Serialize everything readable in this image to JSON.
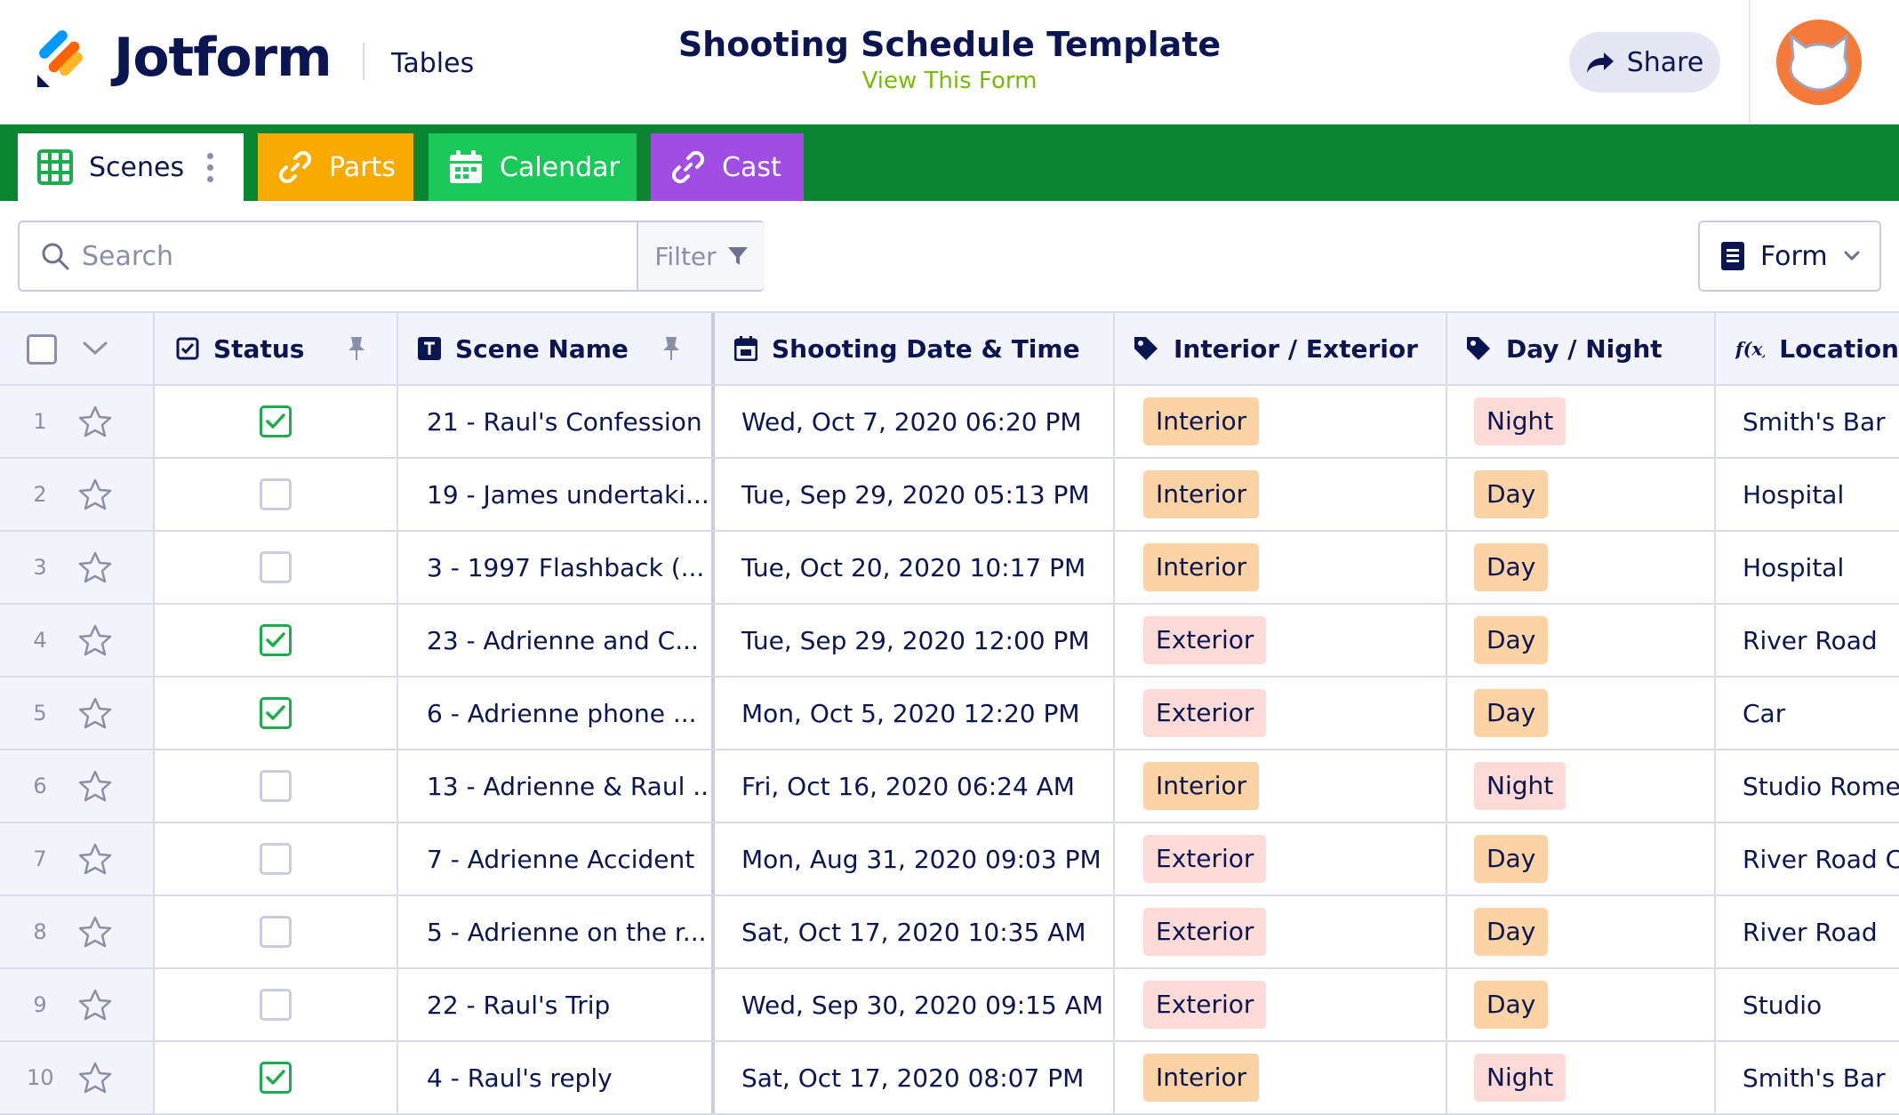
{
  "header": {
    "brand": "Jotform",
    "app_name": "Tables",
    "title": "Shooting Schedule Template",
    "subtitle_link": "View This Form",
    "share_label": "Share"
  },
  "tabs": [
    {
      "label": "Scenes",
      "color": "#ffffff"
    },
    {
      "label": "Parts",
      "color": "#f7ab00"
    },
    {
      "label": "Calendar",
      "color": "#1bc95a"
    },
    {
      "label": "Cast",
      "color": "#9f4de3"
    }
  ],
  "toolbar": {
    "search_placeholder": "Search",
    "filter_label": "Filter",
    "form_label": "Form"
  },
  "columns": {
    "status": "Status",
    "scene": "Scene Name",
    "date": "Shooting Date & Time",
    "ie": "Interior / Exterior",
    "dn": "Day / Night",
    "location": "Location"
  },
  "tag_colors": {
    "Interior": "#fbd3a4",
    "Exterior": "#fcdad7",
    "Day": "#fbd3a4",
    "Night": "#fcdad7"
  },
  "rows": [
    {
      "num": "1",
      "status": true,
      "scene": "21 - Raul's Confession",
      "date": "Wed, Oct 7, 2020 06:20 PM",
      "ie": "Interior",
      "dn": "Night",
      "location": "Smith's Bar"
    },
    {
      "num": "2",
      "status": false,
      "scene": "19 - James undertaki...",
      "date": "Tue, Sep 29, 2020 05:13 PM",
      "ie": "Interior",
      "dn": "Day",
      "location": "Hospital"
    },
    {
      "num": "3",
      "status": false,
      "scene": "3 - 1997 Flashback (...",
      "date": "Tue, Oct 20, 2020 10:17 PM",
      "ie": "Interior",
      "dn": "Day",
      "location": "Hospital"
    },
    {
      "num": "4",
      "status": true,
      "scene": "23 - Adrienne and C...",
      "date": "Tue, Sep 29, 2020 12:00 PM",
      "ie": "Exterior",
      "dn": "Day",
      "location": "River Road"
    },
    {
      "num": "5",
      "status": true,
      "scene": "6 - Adrienne phone ...",
      "date": "Mon, Oct 5, 2020 12:20 PM",
      "ie": "Exterior",
      "dn": "Day",
      "location": "Car"
    },
    {
      "num": "6",
      "status": false,
      "scene": "13 - Adrienne & Raul ...",
      "date": "Fri, Oct 16, 2020 06:24 AM",
      "ie": "Interior",
      "dn": "Night",
      "location": "Studio Rome"
    },
    {
      "num": "7",
      "status": false,
      "scene": "7 - Adrienne Accident",
      "date": "Mon, Aug 31, 2020 09:03 PM",
      "ie": "Exterior",
      "dn": "Day",
      "location": "River Road Cc"
    },
    {
      "num": "8",
      "status": false,
      "scene": "5 - Adrienne on the r...",
      "date": "Sat, Oct 17, 2020 10:35 AM",
      "ie": "Exterior",
      "dn": "Day",
      "location": "River Road"
    },
    {
      "num": "9",
      "status": false,
      "scene": "22 - Raul's Trip",
      "date": "Wed, Sep 30, 2020 09:15 AM",
      "ie": "Exterior",
      "dn": "Day",
      "location": "Studio"
    },
    {
      "num": "10",
      "status": true,
      "scene": "4 - Raul's reply",
      "date": "Sat, Oct 17, 2020 08:07 PM",
      "ie": "Interior",
      "dn": "Night",
      "location": "Smith's Bar"
    }
  ]
}
